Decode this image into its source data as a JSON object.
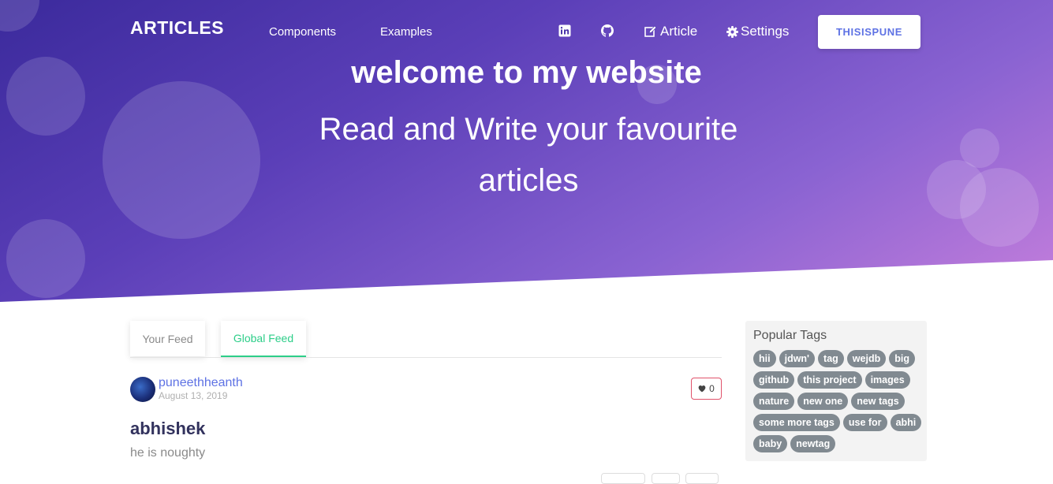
{
  "nav": {
    "brand": "ARTICLES",
    "links": [
      "Components",
      "Examples"
    ],
    "article_label": "Article",
    "settings_label": "Settings",
    "user_button": "THISISPUNE"
  },
  "hero": {
    "title": "welcome to my website",
    "subtitle": "Read and Write your favourite articles"
  },
  "tabs": [
    {
      "label": "Your Feed",
      "active": false
    },
    {
      "label": "Global Feed",
      "active": true
    }
  ],
  "article": {
    "author": "puneethheanth",
    "date": "August 13, 2019",
    "likes": "0",
    "title": "abhishek",
    "description": "he is noughty"
  },
  "sidebar": {
    "title": "Popular Tags",
    "tags": [
      "hii",
      "jdwn'",
      "tag",
      "wejdb",
      "big",
      "github",
      "this project",
      "images",
      "nature",
      "new one",
      "new tags",
      "some more tags",
      "use for",
      "abhi",
      "baby",
      "newtag"
    ]
  },
  "colors": {
    "accent": "#5e72e4",
    "active_tab": "#2dce89",
    "like_border": "#e0526b",
    "tag_bg": "#818a91"
  }
}
